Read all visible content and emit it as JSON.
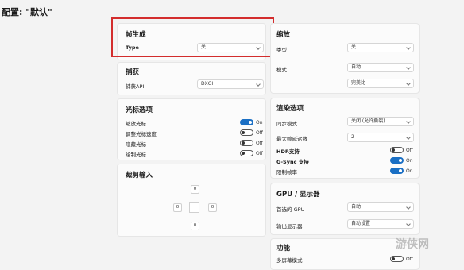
{
  "page_title": "配置: \"默认\"",
  "frame_gen": {
    "title": "帧生成",
    "type_label": "Type",
    "type_value": "关"
  },
  "capture": {
    "title": "捕获",
    "api_label": "捕获API",
    "api_value": "DXGI"
  },
  "cursor": {
    "title": "光标选项",
    "items": [
      {
        "label": "缩放光标",
        "state": "On",
        "on": true
      },
      {
        "label": "调整光标速度",
        "state": "Off",
        "on": false
      },
      {
        "label": "隐藏光标",
        "state": "Off",
        "on": false
      },
      {
        "label": "绘制光标",
        "state": "Off",
        "on": false
      }
    ]
  },
  "crop": {
    "title": "裁剪输入",
    "top": "0",
    "left": "0",
    "right": "0",
    "bottom": "0"
  },
  "scale": {
    "title": "缩放",
    "type_label": "类型",
    "type_value": "关",
    "mode_label": "模式",
    "mode_value": "自动",
    "mode_value2": "完美比"
  },
  "render": {
    "title": "渲染选项",
    "sync_label": "同步模式",
    "sync_value": "关闭 (允许撕裂)",
    "frames_label": "最大帧延迟数",
    "frames_value": "2",
    "items": [
      {
        "label": "HDR支持",
        "state": "Off",
        "on": false
      },
      {
        "label": "G-Sync 支持",
        "state": "On",
        "on": true
      },
      {
        "label": "限制帧率",
        "state": "On",
        "on": true
      }
    ]
  },
  "gpu": {
    "title": "GPU / 显示器",
    "gpu_label": "首选的 GPU",
    "gpu_value": "自动",
    "display_label": "输出显示器",
    "display_value": "自动设置"
  },
  "features": {
    "title": "功能",
    "item_label": "多屏幕模式",
    "item_state": "Off"
  },
  "watermark": "游侠网",
  "colors": {
    "accent": "#1a6fc4",
    "highlight": "#d32d2d"
  }
}
